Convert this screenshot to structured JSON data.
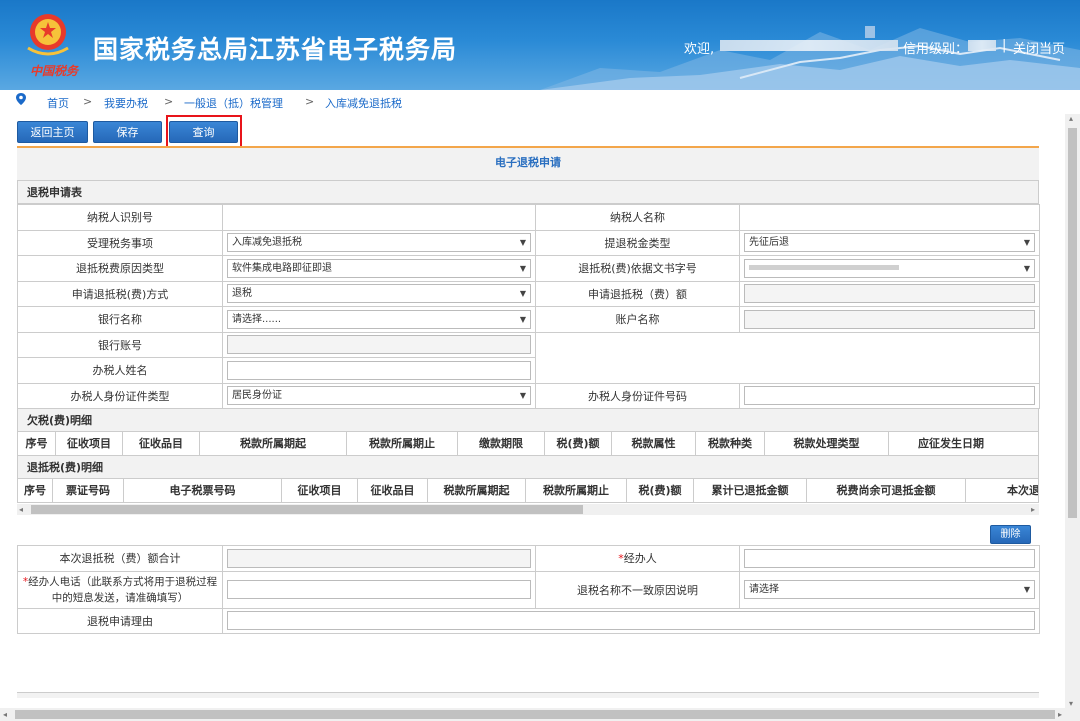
{
  "header": {
    "title": "国家税务总局江苏省电子税务局",
    "logo_text": "中国税务",
    "welcome": "欢迎,",
    "credit_label": "信用级别：",
    "sep": "|",
    "close": "关闭当页"
  },
  "breadcrumb": [
    "首页",
    "我要办税",
    "一般退（抵）税管理",
    "入库减免退抵税"
  ],
  "breadcrumb_sep": ">",
  "toolbar": {
    "home": "返回主页",
    "save": "保存",
    "query": "查询"
  },
  "panel_title": "电子退税申请",
  "section_apply": "退税申请表",
  "form": {
    "taxpayer_id": "纳税人识别号",
    "taxpayer_name": "纳税人名称",
    "handle_item": "受理税务事项",
    "handle_item_val": "入库减免退抵税",
    "fund_type": "提退税金类型",
    "fund_type_val": "先征后退",
    "reason_type": "退抵税费原因类型",
    "reason_type_val": "软件集成电路即征即退",
    "doc_no": "退抵税(费)依据文书字号",
    "method": "申请退抵税(费)方式",
    "method_val": "退税",
    "amount": "申请退抵税（费）额",
    "bank": "银行名称",
    "bank_val": "请选择......",
    "account_name": "账户名称",
    "bank_account": "银行账号",
    "agent_name": "办税人姓名",
    "id_type": "办税人身份证件类型",
    "id_type_val": "居民身份证",
    "id_no": "办税人身份证件号码"
  },
  "section_owed": "欠税(费)明细",
  "owed_headers": [
    "序号",
    "征收项目",
    "征收品目",
    "税款所属期起",
    "税款所属期止",
    "缴款期限",
    "税(费)额",
    "税款属性",
    "税款种类",
    "税款处理类型",
    "应征发生日期"
  ],
  "section_refund": "退抵税(费)明细",
  "refund_headers": [
    "序号",
    "票证号码",
    "电子税票号码",
    "征收项目",
    "征收品目",
    "税款所属期起",
    "税款所属期止",
    "税(费)额",
    "累计已退抵金额",
    "税费尚余可退抵金额",
    "本次退"
  ],
  "delete": "删除",
  "bottom": {
    "total": "本次退抵税（费）额合计",
    "handler": "经办人",
    "req_mark": "*",
    "phone_line1": "经办人电话（此联系方式将用于退税过程",
    "phone_line2": "中的短息发送，请准确填写）",
    "mismatch": "退税名称不一致原因说明",
    "mismatch_val": "请选择",
    "reason": "退税申请理由"
  }
}
